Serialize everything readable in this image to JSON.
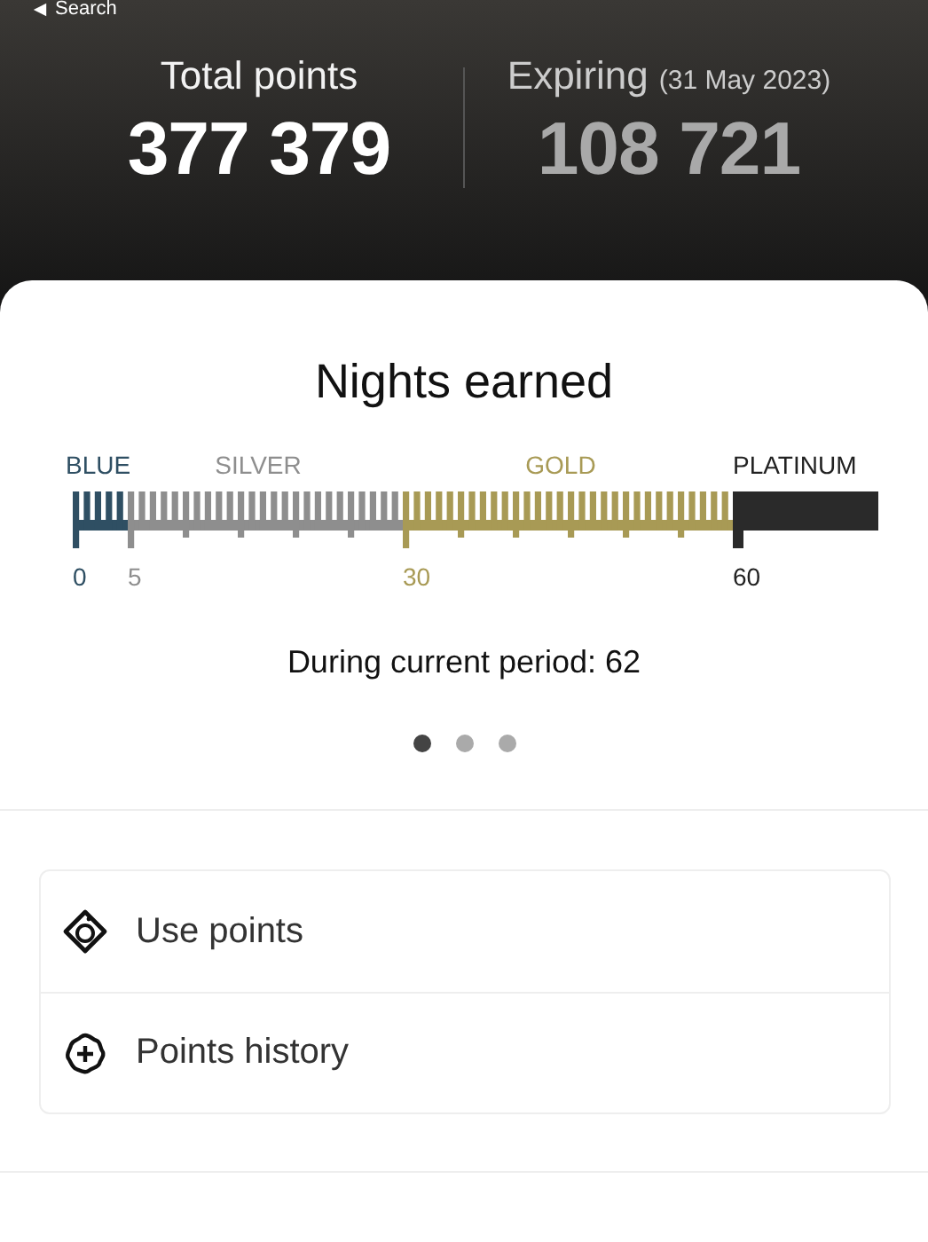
{
  "back_link": {
    "label": "Search"
  },
  "summary": [
    {
      "label": "Total points",
      "value": "377 379",
      "kind": "total"
    },
    {
      "label": "Expiring",
      "note": "(31 May 2023)",
      "value": "108 721",
      "kind": "expiring"
    }
  ],
  "nights": {
    "title": "Nights earned",
    "tiers": [
      {
        "name": "BLUE",
        "start": "0",
        "color": "#2f4f63"
      },
      {
        "name": "SILVER",
        "start": "5",
        "color": "#8e8e8e"
      },
      {
        "name": "GOLD",
        "start": "30",
        "color": "#a89a55"
      },
      {
        "name": "PLATINUM",
        "start": "60",
        "color": "#2a2a2a"
      }
    ],
    "period_text": "During current period: 62"
  },
  "pager": [
    {
      "selected": true
    },
    {
      "selected": false
    },
    {
      "selected": false
    }
  ],
  "actions": [
    {
      "label": "Use points",
      "kind": "coupon"
    },
    {
      "label": "Points history",
      "kind": "history"
    }
  ]
}
